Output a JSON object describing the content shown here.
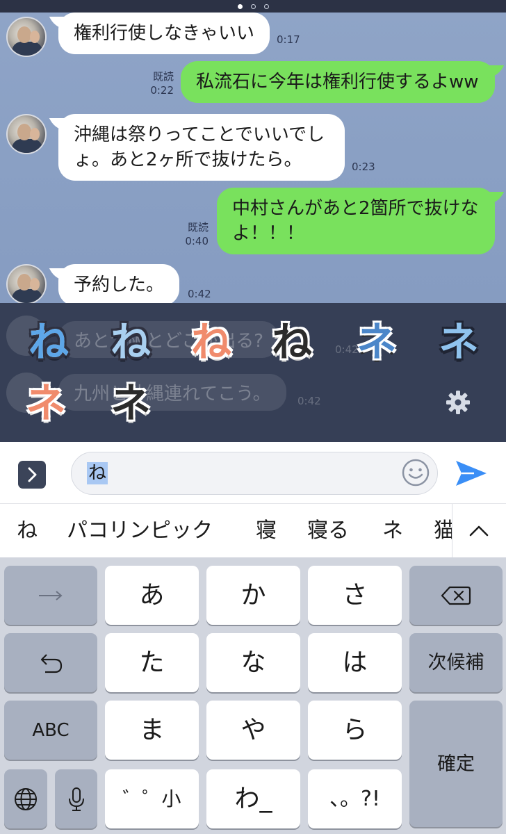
{
  "pager": {
    "dots": 3,
    "active_index": 0
  },
  "chat": {
    "messages": [
      {
        "side": "in",
        "text": "権利行使しなきゃいい",
        "time": "0:17"
      },
      {
        "side": "out",
        "text": "私流石に今年は権利行使するよww",
        "read": "既読",
        "time": "0:22"
      },
      {
        "side": "in",
        "text": "沖縄は祭りってことでいいでし\nょ。あと2ヶ所で抜けたら。",
        "time": "0:23"
      },
      {
        "side": "out",
        "text": "中村さんがあと2箇所で抜けな\nよ！！！",
        "read": "既読",
        "time": "0:40"
      },
      {
        "side": "in",
        "text": "予約した。",
        "time": "0:42"
      }
    ],
    "hidden_messages": [
      {
        "text": "あと大阪とどこか出る?",
        "time": "0:42"
      },
      {
        "text": "九州と沖縄連れてこう。",
        "time": "0:42"
      }
    ]
  },
  "sticker_suggestions": {
    "glyphs": [
      "ね",
      "ね",
      "ね",
      "ね",
      "ネ",
      "ネ",
      "ネ",
      "ネ"
    ],
    "settings_icon": "gear-icon"
  },
  "input": {
    "typed_text": "ね",
    "expand_icon": "chevron-right-icon",
    "emoji_icon": "smiley-icon",
    "send_icon": "send-arrow-icon"
  },
  "predictions": {
    "candidates": [
      "ね",
      "パコリンピック",
      "寝",
      "寝る",
      "ネ",
      "猫"
    ],
    "expand_icon": "chevron-up-icon"
  },
  "keyboard": {
    "row1": {
      "left_icon": "arrow-right-icon",
      "keys": [
        "あ",
        "か",
        "さ"
      ],
      "right_icon": "delete-backspace-icon"
    },
    "row2": {
      "left_icon": "undo-icon",
      "keys": [
        "た",
        "な",
        "は"
      ],
      "right": "次候補"
    },
    "row3": {
      "left": "ABC",
      "keys": [
        "ま",
        "や",
        "ら"
      ],
      "right": "確定"
    },
    "row4": {
      "globe_icon": "globe-icon",
      "mic_icon": "microphone-icon",
      "dakuten": "゛゜小",
      "wa": "わ_",
      "punct": "、。?!"
    }
  },
  "colors": {
    "chat_bg": "#8aa0c4",
    "incoming_bubble": "#ffffff",
    "outgoing_bubble": "#79e15d",
    "overlay_bg": "#3a445c",
    "send_blue": "#3a8ef6",
    "keyboard_bg": "#d1d5de",
    "dark_key": "#a8b0c0"
  }
}
